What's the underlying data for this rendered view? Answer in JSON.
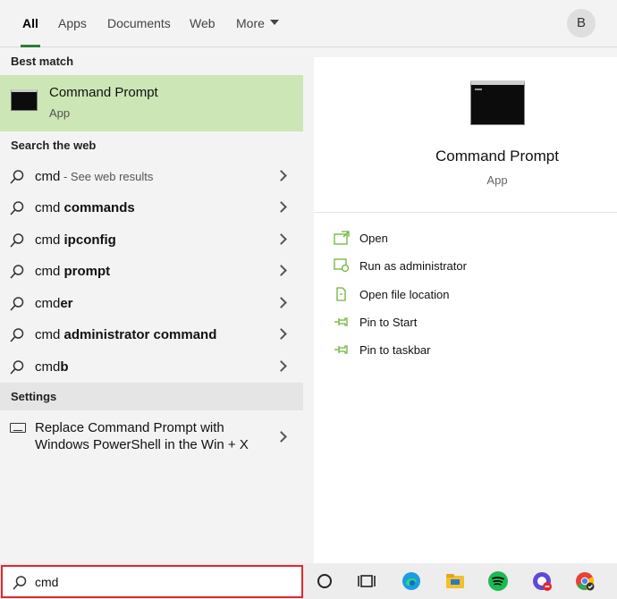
{
  "tabs": [
    {
      "label": "All",
      "active": true
    },
    {
      "label": "Apps"
    },
    {
      "label": "Documents"
    },
    {
      "label": "Web"
    },
    {
      "label": "More"
    }
  ],
  "avatar": {
    "initial": "B"
  },
  "best_match": {
    "heading": "Best match",
    "title": "Command Prompt",
    "subtitle": "App"
  },
  "search_web": {
    "heading": "Search the web",
    "items": [
      {
        "prefix": "cmd",
        "bold": "",
        "hint": " - See web results"
      },
      {
        "prefix": "cmd ",
        "bold": "commands",
        "hint": ""
      },
      {
        "prefix": "cmd ",
        "bold": "ipconfig",
        "hint": ""
      },
      {
        "prefix": "cmd ",
        "bold": "prompt",
        "hint": ""
      },
      {
        "prefix": "cmd",
        "bold": "er",
        "hint": ""
      },
      {
        "prefix": "cmd ",
        "bold": "administrator command",
        "hint": ""
      },
      {
        "prefix": "cmd",
        "bold": "b",
        "hint": ""
      }
    ]
  },
  "settings": {
    "heading": "Settings",
    "item_label": "Replace Command Prompt with Windows PowerShell in the Win + X"
  },
  "detail": {
    "title": "Command Prompt",
    "subtitle": "App",
    "actions": [
      {
        "label": "Open",
        "icon": "open-icon"
      },
      {
        "label": "Run as administrator",
        "icon": "run-as-admin-icon"
      },
      {
        "label": "Open file location",
        "icon": "file-location-icon"
      },
      {
        "label": "Pin to Start",
        "icon": "pin-icon"
      },
      {
        "label": "Pin to taskbar",
        "icon": "pin-icon"
      }
    ]
  },
  "taskbar": {
    "search_value": "cmd",
    "icons": [
      "cortana-icon",
      "task-view-icon",
      "edge-icon",
      "file-explorer-icon",
      "spotify-icon",
      "app-icon",
      "chrome-icon"
    ]
  },
  "colors": {
    "accent_green": "#2d7d3a",
    "best_match_bg": "#cce6b5",
    "action_icon": "#6fb33b",
    "search_highlight_border": "#e3262d"
  }
}
